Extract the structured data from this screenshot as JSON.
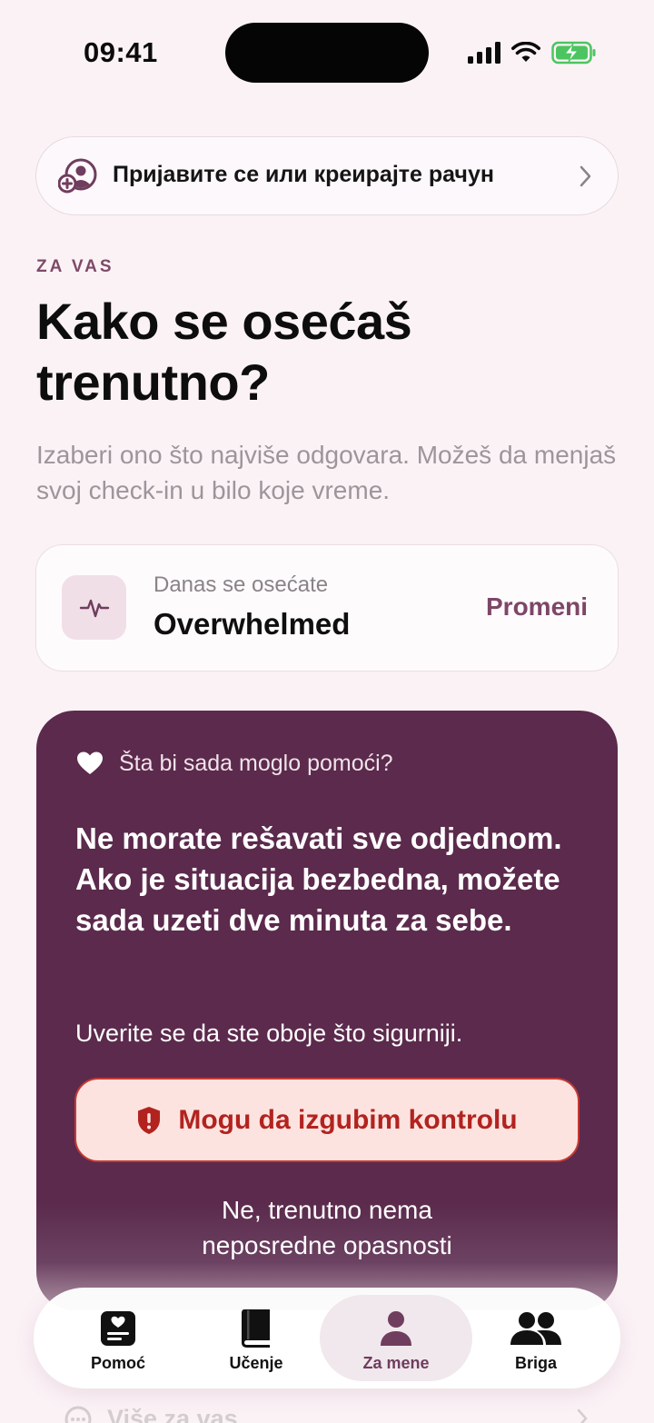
{
  "status_bar": {
    "time": "09:41"
  },
  "signin": {
    "label": "Пријавите се или креирајте рачун"
  },
  "header": {
    "eyebrow": "ZA VAS",
    "title": "Kako se osećaš trenutno?",
    "subtitle": "Izaberi ono što najviše odgovara. Možeš da menjaš svoj check-in u bilo koje vreme."
  },
  "mood": {
    "caption": "Danas se osećate",
    "value": "Overwhelmed",
    "change_label": "Promeni"
  },
  "help": {
    "eyebrow": "Šta bi sada moglo pomoći?",
    "message": "Ne morate rešavati sve odjednom. Ako je situacija bezbedna, možete sada uzeti dve minuta za sebe.",
    "sub": "Uverite se da ste oboje što sigurniji.",
    "danger_button": "Mogu da izgubim kontrolu",
    "no_danger_link": "Ne, trenutno nema neposredne opasnosti"
  },
  "more": {
    "label": "Više za vas"
  },
  "tabs": [
    {
      "label": "Pomoć",
      "icon": "card-heart-icon"
    },
    {
      "label": "Učenje",
      "icon": "book-icon"
    },
    {
      "label": "Za mene",
      "icon": "person-icon",
      "active": true
    },
    {
      "label": "Briga",
      "icon": "people-icon"
    }
  ],
  "colors": {
    "background": "#fbf2f6",
    "accent": "#7d4667",
    "help_card": "#5b2a4c",
    "danger": "#b2231f",
    "danger_bg": "#fde3e0"
  }
}
